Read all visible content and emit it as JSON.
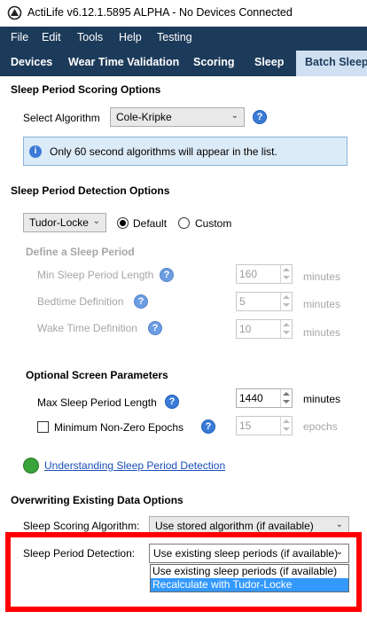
{
  "window": {
    "title": "ActiLife v6.12.1.5895 ALPHA - No Devices Connected",
    "app_icon": "actilife-logo-icon"
  },
  "menu": {
    "items": [
      "File",
      "Edit",
      "Tools",
      "Help",
      "Testing"
    ]
  },
  "tabs": {
    "items": [
      "Devices",
      "Wear Time Validation",
      "Scoring",
      "Sleep"
    ],
    "active": "Batch Sleep"
  },
  "scoring_options": {
    "title": "Sleep Period Scoring Options",
    "select_algorithm_label": "Select Algorithm",
    "algorithm_value": "Cole-Kripke",
    "info_text": "Only 60 second algorithms will appear in the list."
  },
  "detection_options": {
    "title": "Sleep Period Detection Options",
    "method_value": "Tudor-Locke",
    "radio_default": "Default",
    "radio_custom": "Custom",
    "selected_radio": "Default",
    "define_title": "Define a Sleep Period",
    "min_label": "Min Sleep Period Length",
    "min_value": "160",
    "bedtime_label": "Bedtime Definition",
    "bedtime_value": "5",
    "wake_label": "Wake Time Definition",
    "wake_value": "10",
    "unit_minutes": "minutes"
  },
  "screen_params": {
    "title": "Optional Screen Parameters",
    "max_label": "Max Sleep Period Length",
    "max_value": "1440",
    "max_unit": "minutes",
    "nonzero_label": "Minimum Non-Zero Epochs",
    "nonzero_value": "15",
    "nonzero_unit": "epochs",
    "nonzero_checked": false
  },
  "help_link": {
    "label": "Understanding Sleep Period Detection"
  },
  "overwrite": {
    "title": "Overwriting Existing Data Options",
    "scoring_algo_label": "Sleep Scoring Algorithm:",
    "scoring_algo_value": "Use stored algorithm (if available)",
    "detection_label": "Sleep Period Detection:",
    "detection_value": "Use existing sleep periods (if available)",
    "detection_options": [
      "Use existing sleep periods (if available)",
      "Recalculate with Tudor-Locke"
    ],
    "highlighted_option": "Recalculate with Tudor-Locke"
  },
  "colors": {
    "menubar": "#1c3a5a",
    "active_tab": "#cfe0f2",
    "highlight_frame": "#ff0000",
    "selection": "#3399ff"
  }
}
